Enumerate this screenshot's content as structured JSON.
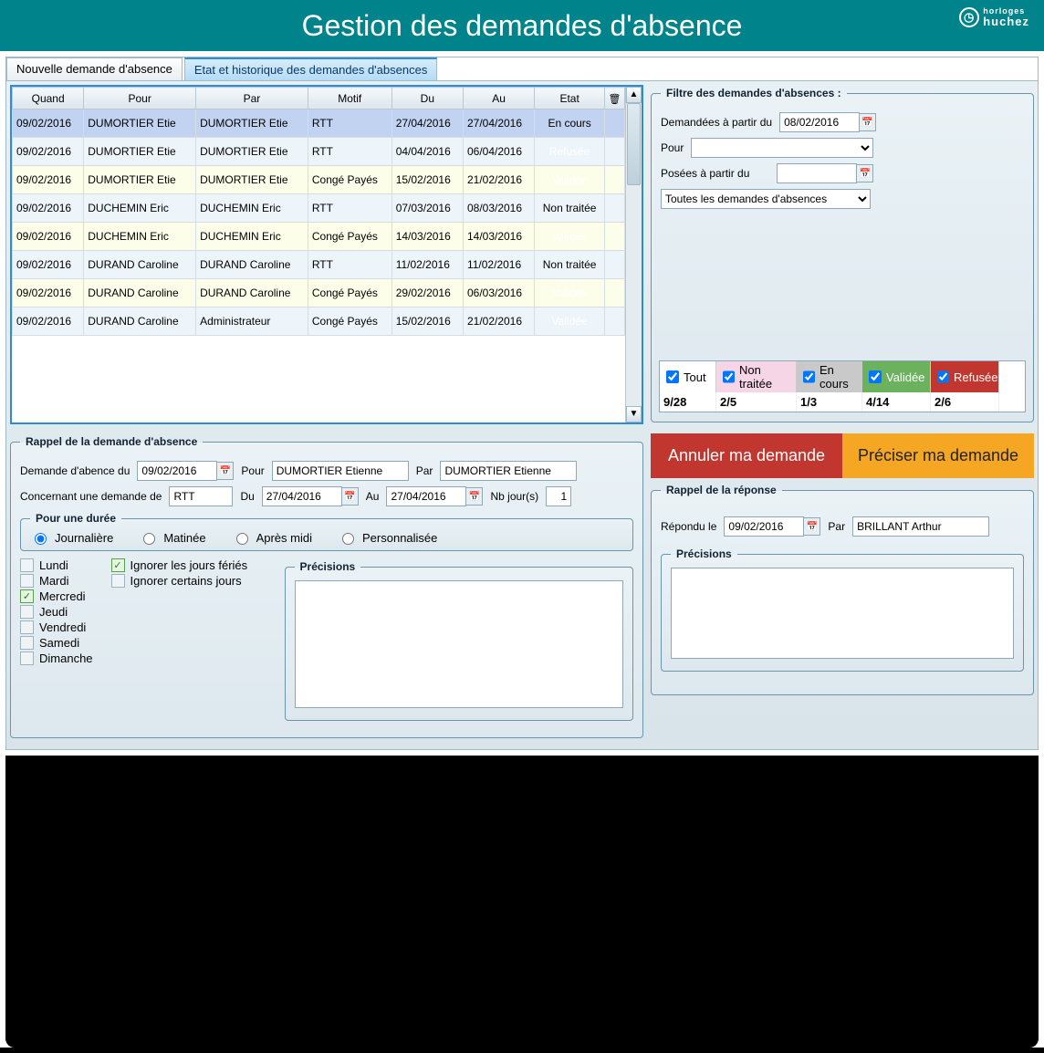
{
  "title": "Gestion des demandes d'absence",
  "brand": {
    "name": "huchez",
    "tag": "horloges"
  },
  "tabs": [
    {
      "label": "Nouvelle demande d'absence",
      "active": false
    },
    {
      "label": "Etat et historique des demandes d'absences",
      "active": true
    }
  ],
  "table": {
    "headers": [
      "Quand",
      "Pour",
      "Par",
      "Motif",
      "Du",
      "Au",
      "Etat"
    ],
    "rows": [
      {
        "quand": "09/02/2016",
        "pour": "DUMORTIER Etie",
        "par": "DUMORTIER Etie",
        "motif": "RTT",
        "du": "27/04/2016",
        "au": "27/04/2016",
        "etat": "En cours",
        "etatClass": "etat-encours",
        "rowClass": "row-blue"
      },
      {
        "quand": "09/02/2016",
        "pour": "DUMORTIER Etie",
        "par": "DUMORTIER Etie",
        "motif": "RTT",
        "du": "04/04/2016",
        "au": "06/04/2016",
        "etat": "Refusée",
        "etatClass": "etat-refusee",
        "rowClass": "row-ice"
      },
      {
        "quand": "09/02/2016",
        "pour": "DUMORTIER Etie",
        "par": "DUMORTIER Etie",
        "motif": "Congé Payés",
        "du": "15/02/2016",
        "au": "21/02/2016",
        "etat": "Validée",
        "etatClass": "etat-validee",
        "rowClass": "row-cream"
      },
      {
        "quand": "09/02/2016",
        "pour": "DUCHEMIN Eric",
        "par": "DUCHEMIN Eric",
        "motif": "RTT",
        "du": "07/03/2016",
        "au": "08/03/2016",
        "etat": "Non traitée",
        "etatClass": "etat-nontraitee",
        "rowClass": "row-ice"
      },
      {
        "quand": "09/02/2016",
        "pour": "DUCHEMIN Eric",
        "par": "DUCHEMIN Eric",
        "motif": "Congé Payés",
        "du": "14/03/2016",
        "au": "14/03/2016",
        "etat": "Validée",
        "etatClass": "etat-validee",
        "rowClass": "row-cream"
      },
      {
        "quand": "09/02/2016",
        "pour": "DURAND Caroline",
        "par": "DURAND Caroline",
        "motif": "RTT",
        "du": "11/02/2016",
        "au": "11/02/2016",
        "etat": "Non traitée",
        "etatClass": "etat-nontraitee",
        "rowClass": "row-ice"
      },
      {
        "quand": "09/02/2016",
        "pour": "DURAND Caroline",
        "par": "DURAND Caroline",
        "motif": "Congé Payés",
        "du": "29/02/2016",
        "au": "06/03/2016",
        "etat": "Validée",
        "etatClass": "etat-validee",
        "rowClass": "row-cream"
      },
      {
        "quand": "09/02/2016",
        "pour": "DURAND Caroline",
        "par": "Administrateur",
        "motif": "Congé Payés",
        "du": "15/02/2016",
        "au": "21/02/2016",
        "etat": "Validée",
        "etatClass": "etat-validee",
        "rowClass": "row-ice"
      }
    ]
  },
  "filter": {
    "legend": "Filtre des demandes d'absences :",
    "demandees_label": "Demandées à partir du",
    "demandees_value": "08/02/2016",
    "pour_label": "Pour",
    "pour_value": "",
    "posees_label": "Posées à partir du",
    "posees_value": "",
    "scope_value": "Toutes les demandes d'absences",
    "status": {
      "items": [
        {
          "label": "Tout",
          "checked": true,
          "cls": "",
          "count": "9/28"
        },
        {
          "label": "Non traitée",
          "checked": true,
          "cls": "bg-nt",
          "count": "2/5"
        },
        {
          "label": "En cours",
          "checked": true,
          "cls": "bg-ec",
          "count": "1/3"
        },
        {
          "label": "Validée",
          "checked": true,
          "cls": "bg-va",
          "count": "4/14"
        },
        {
          "label": "Refusée",
          "checked": true,
          "cls": "bg-re",
          "count": "2/6"
        }
      ]
    }
  },
  "rappel": {
    "legend": "Rappel de la demande d'absence",
    "demande_label": "Demande d'abence du",
    "demande_value": "09/02/2016",
    "pour_label": "Pour",
    "pour_value": "DUMORTIER Etienne",
    "par_label": "Par",
    "par_value": "DUMORTIER Etienne",
    "concernant_label": "Concernant une demande de",
    "concernant_value": "RTT",
    "du_label": "Du",
    "du_value": "27/04/2016",
    "au_label": "Au",
    "au_value": "27/04/2016",
    "nbj_label": "Nb jour(s)",
    "nbj_value": "1",
    "duration": {
      "legend": "Pour une durée",
      "options": [
        "Journalière",
        "Matinée",
        "Après midi",
        "Personnalisée"
      ],
      "selected": "Journalière"
    },
    "days": {
      "labels": [
        "Lundi",
        "Mardi",
        "Mercredi",
        "Jeudi",
        "Vendredi",
        "Samedi",
        "Dimanche"
      ],
      "checked": [
        "Mercredi"
      ]
    },
    "ignore_feries": {
      "label": "Ignorer les jours fériés",
      "checked": true
    },
    "ignore_certains": {
      "label": "Ignorer certains jours",
      "checked": false
    },
    "precisions_label": "Précisions",
    "precisions_value": ""
  },
  "actions": {
    "cancel": "Annuler ma demande",
    "precise": "Préciser ma demande"
  },
  "reponse": {
    "legend": "Rappel de la réponse",
    "repondu_label": "Répondu le",
    "repondu_value": "09/02/2016",
    "par_label": "Par",
    "par_value": "BRILLANT Arthur",
    "precisions_label": "Précisions",
    "precisions_value": ""
  }
}
